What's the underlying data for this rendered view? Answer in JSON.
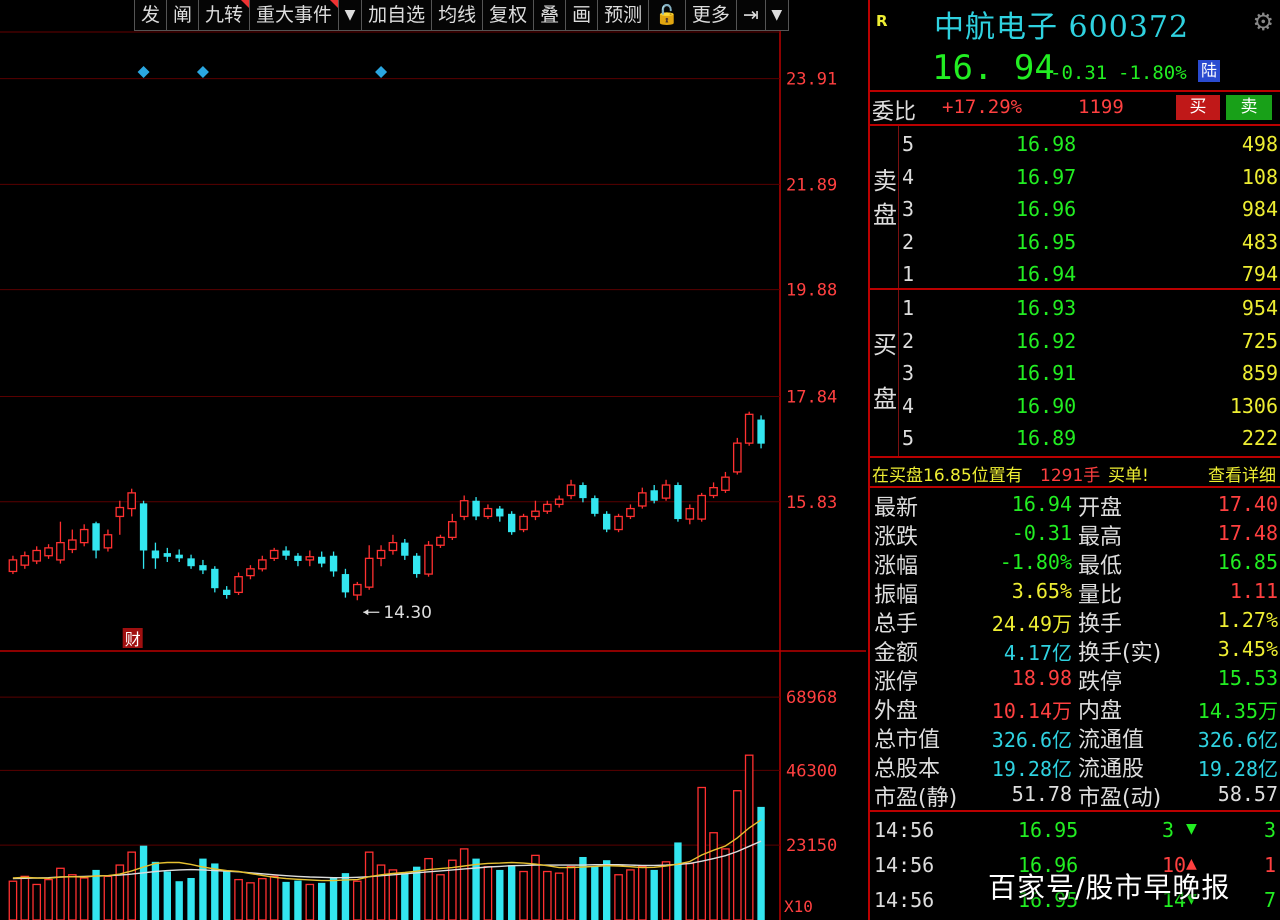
{
  "toolbar": {
    "items": [
      {
        "label": "发",
        "flag": false,
        "dropdown": false
      },
      {
        "label": "阐",
        "flag": false,
        "dropdown": false
      },
      {
        "label": "九转",
        "flag": true,
        "dropdown": false
      },
      {
        "label": "重大事件",
        "flag": true,
        "dropdown": false
      },
      {
        "label": "▼",
        "flag": false,
        "dropdown": true
      },
      {
        "label": "加自选",
        "flag": false,
        "dropdown": false
      },
      {
        "label": "均线",
        "flag": false,
        "dropdown": false
      },
      {
        "label": "复权",
        "flag": false,
        "dropdown": false
      },
      {
        "label": "叠",
        "flag": false,
        "dropdown": false
      },
      {
        "label": "画",
        "flag": false,
        "dropdown": false
      },
      {
        "label": "预测",
        "flag": false,
        "dropdown": false
      },
      {
        "label": "🔓",
        "flag": false,
        "dropdown": false
      },
      {
        "label": "更多",
        "flag": false,
        "dropdown": false
      },
      {
        "label": "⇥",
        "flag": false,
        "dropdown": false
      },
      {
        "label": "▼",
        "flag": false,
        "dropdown": true
      }
    ]
  },
  "chart_data": {
    "type": "candlestick",
    "price_axis_labels": [
      "23.91",
      "21.89",
      "19.88",
      "17.84",
      "15.83"
    ],
    "price_axis_values": [
      23.91,
      21.89,
      19.88,
      17.84,
      15.83
    ],
    "ylim": [
      13.0,
      24.8
    ],
    "low_annotation": "14.30",
    "low_annotation_value": 14.3,
    "finance_marker": "财",
    "event_marker_indices": [
      11,
      16,
      31
    ],
    "volume_axis_labels": [
      "68968",
      "46300",
      "23150"
    ],
    "volume_axis_values": [
      68968,
      46300,
      23150
    ],
    "volume_ylim": [
      0,
      82000
    ],
    "volume_unit": "X10",
    "candles": [
      {
        "o": 14.5,
        "c": 14.72,
        "h": 14.8,
        "l": 14.45,
        "v": 12000
      },
      {
        "o": 14.62,
        "c": 14.8,
        "h": 14.88,
        "l": 14.55,
        "v": 13500
      },
      {
        "o": 14.7,
        "c": 14.9,
        "h": 14.98,
        "l": 14.64,
        "v": 11000
      },
      {
        "o": 14.8,
        "c": 14.95,
        "h": 15.02,
        "l": 14.74,
        "v": 12500
      },
      {
        "o": 14.72,
        "c": 15.05,
        "h": 15.45,
        "l": 14.65,
        "v": 16000
      },
      {
        "o": 14.92,
        "c": 15.1,
        "h": 15.3,
        "l": 14.85,
        "v": 14000
      },
      {
        "o": 15.05,
        "c": 15.3,
        "h": 15.4,
        "l": 14.98,
        "v": 13000
      },
      {
        "o": 15.42,
        "c": 14.9,
        "h": 15.45,
        "l": 14.75,
        "v": 15500
      },
      {
        "o": 14.95,
        "c": 15.2,
        "h": 15.3,
        "l": 14.88,
        "v": 13500
      },
      {
        "o": 15.55,
        "c": 15.72,
        "h": 15.85,
        "l": 15.2,
        "v": 17000
      },
      {
        "o": 15.7,
        "c": 16.0,
        "h": 16.08,
        "l": 15.55,
        "v": 21000
      },
      {
        "o": 15.8,
        "c": 14.9,
        "h": 15.85,
        "l": 14.55,
        "v": 23000
      },
      {
        "o": 14.9,
        "c": 14.75,
        "h": 15.05,
        "l": 14.55,
        "v": 18000
      },
      {
        "o": 14.85,
        "c": 14.78,
        "h": 14.95,
        "l": 14.68,
        "v": 15000
      },
      {
        "o": 14.82,
        "c": 14.75,
        "h": 14.92,
        "l": 14.68,
        "v": 12000
      },
      {
        "o": 14.75,
        "c": 14.6,
        "h": 14.82,
        "l": 14.55,
        "v": 13000
      },
      {
        "o": 14.62,
        "c": 14.52,
        "h": 14.72,
        "l": 14.45,
        "v": 19000
      },
      {
        "o": 14.55,
        "c": 14.18,
        "h": 14.6,
        "l": 14.1,
        "v": 17500
      },
      {
        "o": 14.15,
        "c": 14.05,
        "h": 14.22,
        "l": 13.98,
        "v": 15000
      },
      {
        "o": 14.1,
        "c": 14.4,
        "h": 14.48,
        "l": 14.05,
        "v": 12500
      },
      {
        "o": 14.42,
        "c": 14.55,
        "h": 14.62,
        "l": 14.35,
        "v": 11500
      },
      {
        "o": 14.55,
        "c": 14.72,
        "h": 14.8,
        "l": 14.5,
        "v": 12800
      },
      {
        "o": 14.75,
        "c": 14.9,
        "h": 14.95,
        "l": 14.7,
        "v": 13500
      },
      {
        "o": 14.9,
        "c": 14.8,
        "h": 14.98,
        "l": 14.72,
        "v": 11800
      },
      {
        "o": 14.8,
        "c": 14.7,
        "h": 14.85,
        "l": 14.6,
        "v": 12200
      },
      {
        "o": 14.72,
        "c": 14.78,
        "h": 14.9,
        "l": 14.6,
        "v": 11000
      },
      {
        "o": 14.78,
        "c": 14.65,
        "h": 14.88,
        "l": 14.58,
        "v": 11500
      },
      {
        "o": 14.8,
        "c": 14.5,
        "h": 14.88,
        "l": 14.4,
        "v": 13000
      },
      {
        "o": 14.45,
        "c": 14.1,
        "h": 14.55,
        "l": 14.0,
        "v": 14500
      },
      {
        "o": 14.05,
        "c": 14.25,
        "h": 14.3,
        "l": 13.95,
        "v": 12000
      },
      {
        "o": 14.2,
        "c": 14.75,
        "h": 15.0,
        "l": 14.15,
        "v": 21000
      },
      {
        "o": 14.75,
        "c": 14.9,
        "h": 15.0,
        "l": 14.6,
        "v": 17000
      },
      {
        "o": 14.9,
        "c": 15.05,
        "h": 15.2,
        "l": 14.82,
        "v": 15500
      },
      {
        "o": 15.05,
        "c": 14.8,
        "h": 15.12,
        "l": 14.72,
        "v": 14500
      },
      {
        "o": 14.8,
        "c": 14.45,
        "h": 14.85,
        "l": 14.38,
        "v": 16500
      },
      {
        "o": 14.45,
        "c": 15.0,
        "h": 15.08,
        "l": 14.4,
        "v": 19000
      },
      {
        "o": 15.0,
        "c": 15.15,
        "h": 15.2,
        "l": 14.95,
        "v": 14000
      },
      {
        "o": 15.15,
        "c": 15.45,
        "h": 15.6,
        "l": 15.1,
        "v": 18500
      },
      {
        "o": 15.55,
        "c": 15.85,
        "h": 15.95,
        "l": 15.48,
        "v": 22000
      },
      {
        "o": 15.85,
        "c": 15.55,
        "h": 15.92,
        "l": 15.48,
        "v": 19000
      },
      {
        "o": 15.55,
        "c": 15.7,
        "h": 15.78,
        "l": 15.5,
        "v": 16500
      },
      {
        "o": 15.7,
        "c": 15.55,
        "h": 15.75,
        "l": 15.45,
        "v": 15500
      },
      {
        "o": 15.6,
        "c": 15.25,
        "h": 15.65,
        "l": 15.2,
        "v": 17000
      },
      {
        "o": 15.3,
        "c": 15.55,
        "h": 15.6,
        "l": 15.25,
        "v": 15000
      },
      {
        "o": 15.55,
        "c": 15.65,
        "h": 15.85,
        "l": 15.48,
        "v": 20000
      },
      {
        "o": 15.65,
        "c": 15.78,
        "h": 15.85,
        "l": 15.6,
        "v": 15000
      },
      {
        "o": 15.78,
        "c": 15.88,
        "h": 15.95,
        "l": 15.72,
        "v": 14500
      },
      {
        "o": 15.95,
        "c": 16.15,
        "h": 16.25,
        "l": 15.88,
        "v": 16500
      },
      {
        "o": 16.15,
        "c": 15.9,
        "h": 16.2,
        "l": 15.82,
        "v": 19500
      },
      {
        "o": 15.9,
        "c": 15.6,
        "h": 15.95,
        "l": 15.55,
        "v": 16500
      },
      {
        "o": 15.6,
        "c": 15.3,
        "h": 15.65,
        "l": 15.25,
        "v": 18500
      },
      {
        "o": 15.3,
        "c": 15.55,
        "h": 15.6,
        "l": 15.25,
        "v": 14000
      },
      {
        "o": 15.55,
        "c": 15.7,
        "h": 15.78,
        "l": 15.5,
        "v": 15500
      },
      {
        "o": 15.75,
        "c": 16.0,
        "h": 16.1,
        "l": 15.7,
        "v": 16500
      },
      {
        "o": 16.05,
        "c": 15.85,
        "h": 16.15,
        "l": 15.8,
        "v": 15500
      },
      {
        "o": 15.9,
        "c": 16.15,
        "h": 16.25,
        "l": 15.85,
        "v": 18000
      },
      {
        "o": 16.15,
        "c": 15.5,
        "h": 16.2,
        "l": 15.45,
        "v": 24000
      },
      {
        "o": 15.5,
        "c": 15.7,
        "h": 15.78,
        "l": 15.4,
        "v": 17500
      },
      {
        "o": 15.5,
        "c": 15.95,
        "h": 16.0,
        "l": 15.45,
        "v": 41000
      },
      {
        "o": 15.95,
        "c": 16.1,
        "h": 16.2,
        "l": 15.9,
        "v": 27000
      },
      {
        "o": 16.05,
        "c": 16.3,
        "h": 16.4,
        "l": 16.0,
        "v": 22000
      },
      {
        "o": 16.4,
        "c": 16.95,
        "h": 17.05,
        "l": 16.35,
        "v": 40000
      },
      {
        "o": 16.95,
        "c": 17.5,
        "h": 17.55,
        "l": 16.9,
        "v": 51000
      },
      {
        "o": 17.4,
        "c": 16.94,
        "h": 17.48,
        "l": 16.85,
        "v": 35000
      }
    ],
    "ma_price_white": [
      14.55,
      14.62,
      14.7,
      14.78,
      14.86,
      14.93,
      15.0,
      15.02,
      15.05,
      15.12,
      15.22,
      15.24,
      15.18,
      15.1,
      15.02,
      14.9,
      14.78,
      14.62,
      14.48,
      14.4,
      14.38,
      14.4,
      14.48,
      14.58,
      14.66,
      14.72,
      14.76,
      14.72,
      14.62,
      14.55,
      14.56,
      14.62,
      14.7,
      14.76,
      14.78,
      14.82,
      14.88,
      14.98,
      15.1,
      15.22,
      15.32,
      15.4,
      15.45,
      15.48,
      15.52,
      15.56,
      15.6,
      15.68,
      15.76,
      15.78,
      15.74,
      15.7,
      15.68,
      15.68,
      15.72,
      15.76,
      15.74,
      15.72,
      15.74,
      15.82,
      15.95,
      16.12,
      16.35,
      16.55
    ],
    "ma_volume_yellow": [
      13000,
      13200,
      13000,
      12900,
      13300,
      13400,
      13300,
      13600,
      13700,
      14200,
      15200,
      16400,
      17500,
      17800,
      17800,
      17200,
      16400,
      15800,
      15300,
      15000,
      14400,
      13800,
      13200,
      12800,
      12600,
      12400,
      12200,
      12200,
      12400,
      12500,
      13400,
      14000,
      14400,
      14700,
      15100,
      15600,
      15900,
      16200,
      16700,
      17200,
      17500,
      17600,
      17800,
      17600,
      17300,
      16800,
      16200,
      16200,
      16400,
      16600,
      16800,
      16700,
      16500,
      16200,
      16300,
      16700,
      17300,
      18100,
      20100,
      21600,
      22900,
      25400,
      28500,
      31000
    ],
    "ma_volume_white": [
      12800,
      12900,
      13000,
      13100,
      13300,
      13400,
      13500,
      13600,
      13700,
      13900,
      14200,
      14600,
      15000,
      15300,
      15500,
      15600,
      15500,
      15300,
      15100,
      14900,
      14600,
      14300,
      14000,
      13700,
      13500,
      13300,
      13200,
      13100,
      13100,
      13200,
      13400,
      13700,
      14000,
      14300,
      14600,
      14900,
      15200,
      15500,
      15800,
      16100,
      16400,
      16600,
      16800,
      16900,
      17000,
      17000,
      17000,
      17000,
      17000,
      17100,
      17100,
      17100,
      17000,
      16900,
      16900,
      17000,
      17200,
      17500,
      18200,
      19000,
      19900,
      21200,
      22800,
      24400
    ]
  },
  "quote": {
    "badge": "R",
    "name": "中航电子 600372",
    "price": "16. 94",
    "change": "-0.31",
    "change_pct": "-1.80%",
    "exchange_tag": "陆"
  },
  "wb": {
    "label": "委比",
    "pct": "+17.29%",
    "diff": "1199",
    "buy_label": "买",
    "sell_label": "卖"
  },
  "ask": {
    "side_label_1": "卖",
    "side_label_2": "盘",
    "rows": [
      {
        "lv": "5",
        "pr": "16.98",
        "vol": "498"
      },
      {
        "lv": "4",
        "pr": "16.97",
        "vol": "108"
      },
      {
        "lv": "3",
        "pr": "16.96",
        "vol": "984"
      },
      {
        "lv": "2",
        "pr": "16.95",
        "vol": "483"
      },
      {
        "lv": "1",
        "pr": "16.94",
        "vol": "794"
      }
    ]
  },
  "bid": {
    "side_label_1": "买",
    "side_label_2": "盘",
    "rows": [
      {
        "lv": "1",
        "pr": "16.93",
        "vol": "954"
      },
      {
        "lv": "2",
        "pr": "16.92",
        "vol": "725"
      },
      {
        "lv": "3",
        "pr": "16.91",
        "vol": "859"
      },
      {
        "lv": "4",
        "pr": "16.90",
        "vol": "1306"
      },
      {
        "lv": "5",
        "pr": "16.89",
        "vol": "222"
      }
    ]
  },
  "notice": {
    "text_a": "在买盘16.85位置有",
    "text_b": "1291手",
    "text_c": "买单!",
    "link": "查看详细"
  },
  "stats": [
    {
      "l1": "最新",
      "v1": "16.94",
      "c1": "#22ee22",
      "l2": "开盘",
      "v2": "17.40",
      "c2": "#ff4040"
    },
    {
      "l1": "涨跌",
      "v1": "-0.31",
      "c1": "#22ee22",
      "l2": "最高",
      "v2": "17.48",
      "c2": "#ff4040"
    },
    {
      "l1": "涨幅",
      "v1": "-1.80%",
      "c1": "#22ee22",
      "l2": "最低",
      "v2": "16.85",
      "c2": "#22ee22"
    },
    {
      "l1": "振幅",
      "v1": "3.65%",
      "c1": "#ee3",
      "l2": "量比",
      "v2": "1.11",
      "c2": "#ff4040"
    },
    {
      "l1": "总手",
      "v1": "24.49万",
      "c1": "#ee3",
      "l2": "换手",
      "v2": "1.27%",
      "c2": "#ee3"
    },
    {
      "l1": "金额",
      "v1": "4.17亿",
      "c1": "#2fd2e0",
      "l2": "换手(实)",
      "v2": "3.45%",
      "c2": "#ee3"
    },
    {
      "l1": "涨停",
      "v1": "18.98",
      "c1": "#ff4040",
      "l2": "跌停",
      "v2": "15.53",
      "c2": "#22ee22"
    },
    {
      "l1": "外盘",
      "v1": "10.14万",
      "c1": "#ff4040",
      "l2": "内盘",
      "v2": "14.35万",
      "c2": "#22ee22"
    },
    {
      "l1": "总市值",
      "v1": "326.6亿",
      "c1": "#2fd2e0",
      "l2": "流通值",
      "v2": "326.6亿",
      "c2": "#2fd2e0"
    },
    {
      "l1": "总股本",
      "v1": "19.28亿",
      "c1": "#2fd2e0",
      "l2": "流通股",
      "v2": "19.28亿",
      "c2": "#2fd2e0"
    },
    {
      "l1": "市盈(静)",
      "v1": "51.78",
      "c1": "#ddd",
      "l2": "市盈(动)",
      "v2": "58.57",
      "c2": "#ddd"
    }
  ],
  "ticks": [
    {
      "t": "14:56",
      "p": "16.95",
      "q": "3",
      "arrow": "down",
      "n": "3"
    },
    {
      "t": "14:56",
      "p": "16.96",
      "q": "10",
      "arrow": "up",
      "n": "1"
    },
    {
      "t": "14:56",
      "p": "16.95",
      "q": "14",
      "arrow": "down",
      "n": "7"
    }
  ],
  "watermark": "百家号/股市早晚报",
  "colors": {
    "up": "#ff3030",
    "down": "#33e6f0",
    "ask_price": "#22ee22",
    "volume": "#ee3",
    "border": "#b00"
  }
}
